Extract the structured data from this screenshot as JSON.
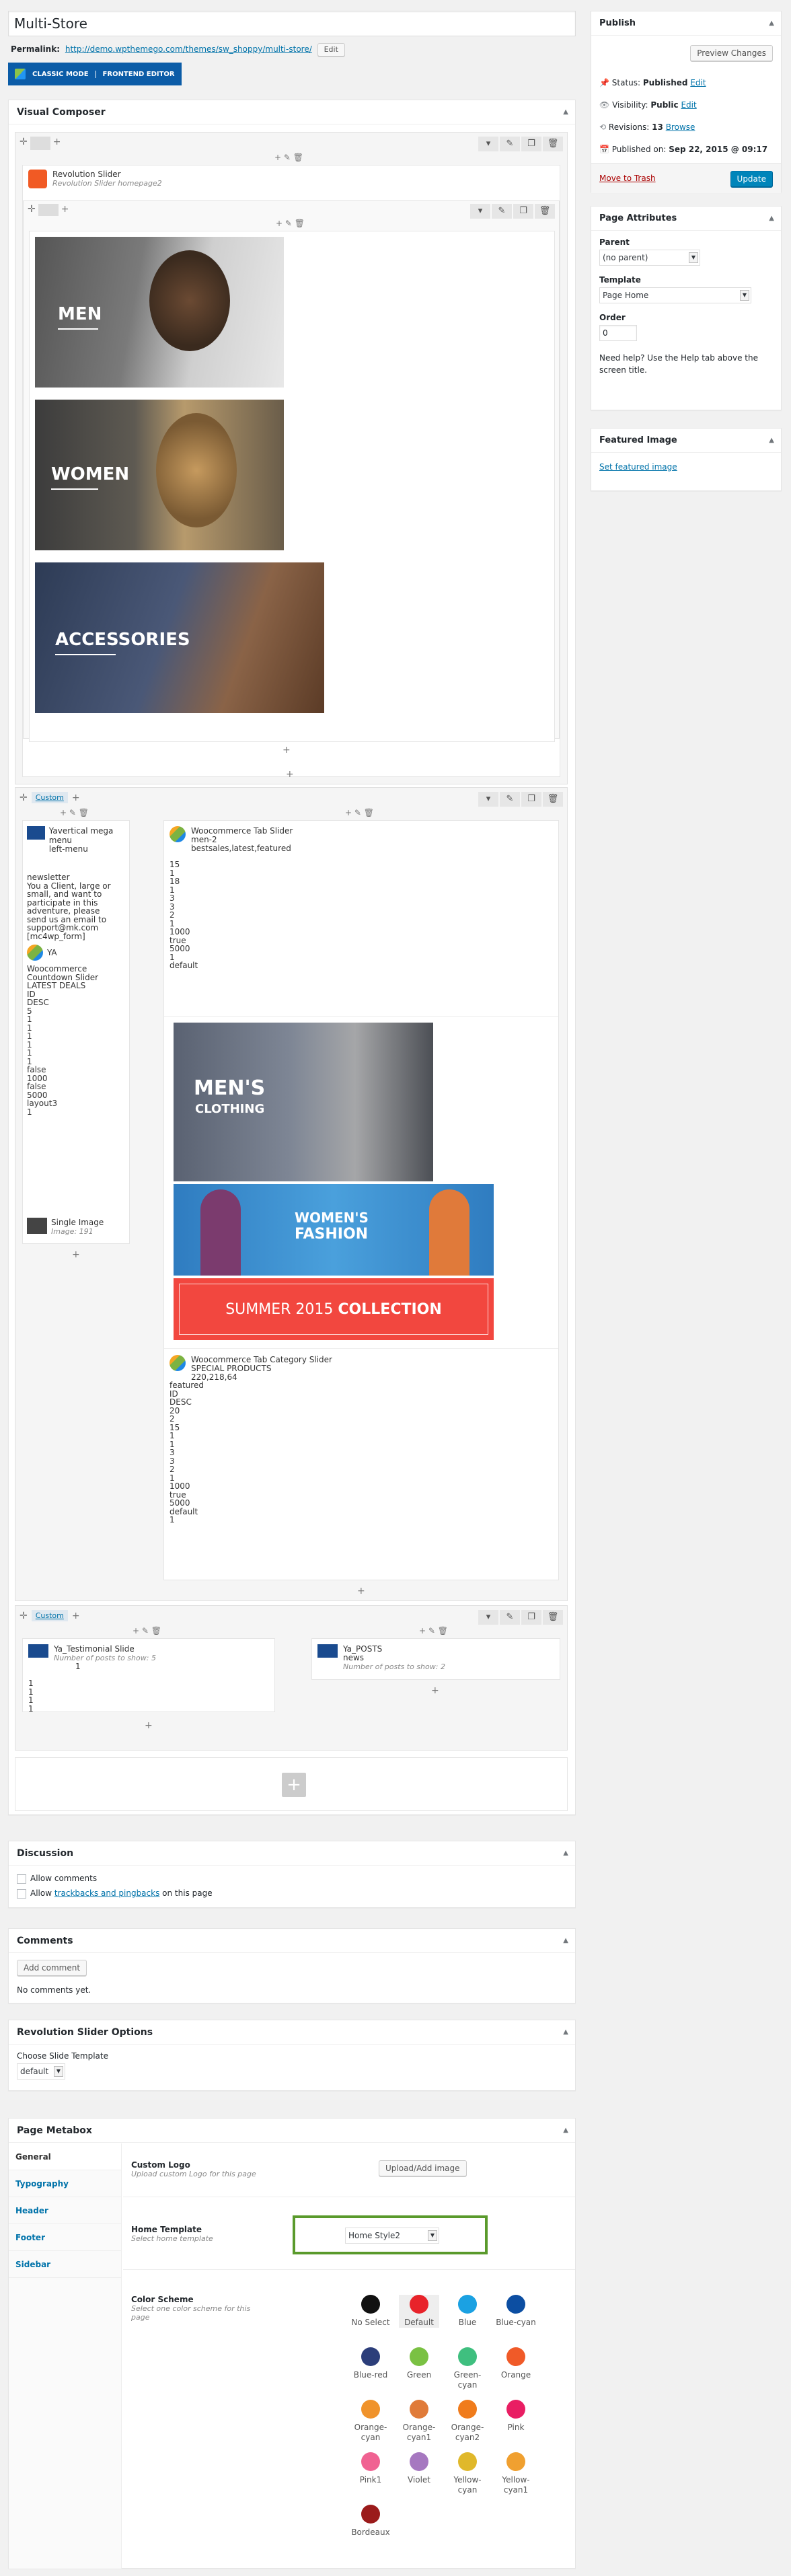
{
  "page": {
    "title": "Multi-Store",
    "permalink_label": "Permalink:",
    "permalink_url": "http://demo.wpthemego.com/themes/sw_shoppy/multi-store/",
    "edit_label": "Edit",
    "classic_mode": "CLASSIC MODE",
    "frontend_editor": "FRONTEND EDITOR"
  },
  "publish": {
    "title": "Publish",
    "preview": "Preview Changes",
    "status_label": "Status:",
    "status_value": "Published",
    "visibility_label": "Visibility:",
    "visibility_value": "Public",
    "revisions_label": "Revisions:",
    "revisions_value": "13",
    "browse": "Browse",
    "published_label": "Published on:",
    "published_value": "Sep 22, 2015 @ 09:17",
    "edit": "Edit",
    "trash": "Move to Trash",
    "update": "Update"
  },
  "attributes": {
    "title": "Page Attributes",
    "parent_label": "Parent",
    "parent_value": "(no parent)",
    "template_label": "Template",
    "template_value": "Page Home",
    "order_label": "Order",
    "order_value": "0",
    "help": "Need help? Use the Help tab above the screen title."
  },
  "featured": {
    "title": "Featured Image",
    "link": "Set featured image"
  },
  "vc": {
    "title": "Visual Composer",
    "rev_slider_title": "Revolution Slider",
    "rev_slider_sub": "Revolution Slider homepage2",
    "tile_men": "MEN",
    "tile_women": "WOMEN",
    "tile_accessories": "ACCESSORIES",
    "custom_tab": "Custom",
    "left": {
      "mega_title": "Yavertical mega menu",
      "mega_sub": "left-menu",
      "newsletter_lines": [
        "newsletter",
        "You a Client, large or",
        "small, and want to",
        "participate in this",
        "adventure, please",
        "send us an email to",
        "support@mk.com",
        "[mc4wp_form]"
      ],
      "ya_title": "YA",
      "countdown_lines": [
        "Woocommerce",
        "Countdown Slider",
        "LATEST DEALS",
        "ID",
        "DESC",
        "5",
        "1",
        "1",
        "1",
        "1",
        "1",
        "1",
        "false",
        "1000",
        "false",
        "5000",
        "layout3",
        "1"
      ],
      "single_image_title": "Single Image",
      "single_image_sub": "Image: 191"
    },
    "tab_slider": {
      "title": "Woocommerce Tab Slider",
      "lines": [
        "men-2",
        "bestsales,latest,featured"
      ],
      "values": [
        "15",
        "1",
        "18",
        "1",
        "3",
        "3",
        "2",
        "1",
        "1000",
        "true",
        "5000",
        "1",
        "default"
      ]
    },
    "banner_men": [
      "MEN'S",
      "CLOTHING"
    ],
    "banner_women": [
      "WOMEN'S",
      "FASHION"
    ],
    "banner_summer_a": "SUMMER 2015",
    "banner_summer_b": "COLLECTION",
    "cat_slider": {
      "title": "Woocommerce Tab Category Slider",
      "lines": [
        "SPECIAL PRODUCTS",
        "220,218,64"
      ],
      "values": [
        "featured",
        "ID",
        "DESC",
        "20",
        "2",
        "15",
        "1",
        "1",
        "3",
        "3",
        "2",
        "1",
        "1000",
        "true",
        "5000",
        "default",
        "1"
      ]
    },
    "testimonial_title": "Ya_Testimonial Slide",
    "testimonial_sub": "Number of posts to show: 5",
    "testimonial_values": [
      "1",
      "1",
      "1",
      "1",
      "1"
    ],
    "posts_title": "Ya_POSTS",
    "posts_sub1": "news",
    "posts_sub2": "Number of posts to show: 2"
  },
  "discussion": {
    "title": "Discussion",
    "allow_comments": "Allow comments",
    "allow": "Allow",
    "trackbacks": "trackbacks and pingbacks",
    "on_page": "on this page"
  },
  "comments": {
    "title": "Comments",
    "add": "Add comment",
    "none": "No comments yet."
  },
  "rev_options": {
    "title": "Revolution Slider Options",
    "choose": "Choose Slide Template",
    "value": "default"
  },
  "metabox": {
    "title": "Page Metabox",
    "tabs": [
      "General",
      "Typography",
      "Header",
      "Footer",
      "Sidebar"
    ],
    "logo_label": "Custom Logo",
    "logo_desc": "Upload custom Logo for this page",
    "logo_btn": "Upload/Add image",
    "home_label": "Home Template",
    "home_desc": "Select home template",
    "home_value": "Home Style2",
    "color_label": "Color Scheme",
    "color_desc": "Select one color scheme for this page",
    "colors": [
      {
        "name": "No Select",
        "color": "#111111"
      },
      {
        "name": "Default",
        "color": "#e8232a"
      },
      {
        "name": "Blue",
        "color": "#1ba1e2"
      },
      {
        "name": "Blue-cyan",
        "color": "#0c4ea2"
      },
      {
        "name": "Blue-red",
        "color": "#2c3e7a"
      },
      {
        "name": "Green",
        "color": "#7ac143"
      },
      {
        "name": "Green-cyan",
        "color": "#3fbf7f"
      },
      {
        "name": "Orange",
        "color": "#f05a28"
      },
      {
        "name": "Orange-cyan",
        "color": "#f0932b"
      },
      {
        "name": "Orange-cyan1",
        "color": "#e07b39"
      },
      {
        "name": "Orange-cyan2",
        "color": "#f07c1c"
      },
      {
        "name": "Pink",
        "color": "#e91e63"
      },
      {
        "name": "Pink1",
        "color": "#f06292"
      },
      {
        "name": "Violet",
        "color": "#a678c0"
      },
      {
        "name": "Yellow-cyan",
        "color": "#e0b82b"
      },
      {
        "name": "Yellow-cyan1",
        "color": "#f0a030"
      },
      {
        "name": "Bordeaux",
        "color": "#9b1b1b"
      }
    ]
  }
}
